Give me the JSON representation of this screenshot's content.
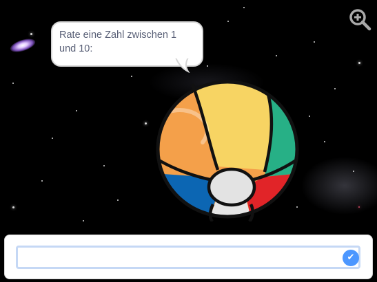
{
  "stage": {
    "backdrop": "space-stars",
    "speech_bubble": {
      "text_line1": "Rate eine Zahl zwischen 1",
      "text_line2": "und 10:"
    },
    "sprite": "beach-ball",
    "zoom_icon": "zoom-in-icon"
  },
  "ask_prompt": {
    "input_value": "",
    "submit_icon": "check-icon",
    "submit_glyph": "✔"
  },
  "colors": {
    "accent": "#4c97ff",
    "input_border": "#c5d8f5",
    "speech_text": "#575e75"
  }
}
